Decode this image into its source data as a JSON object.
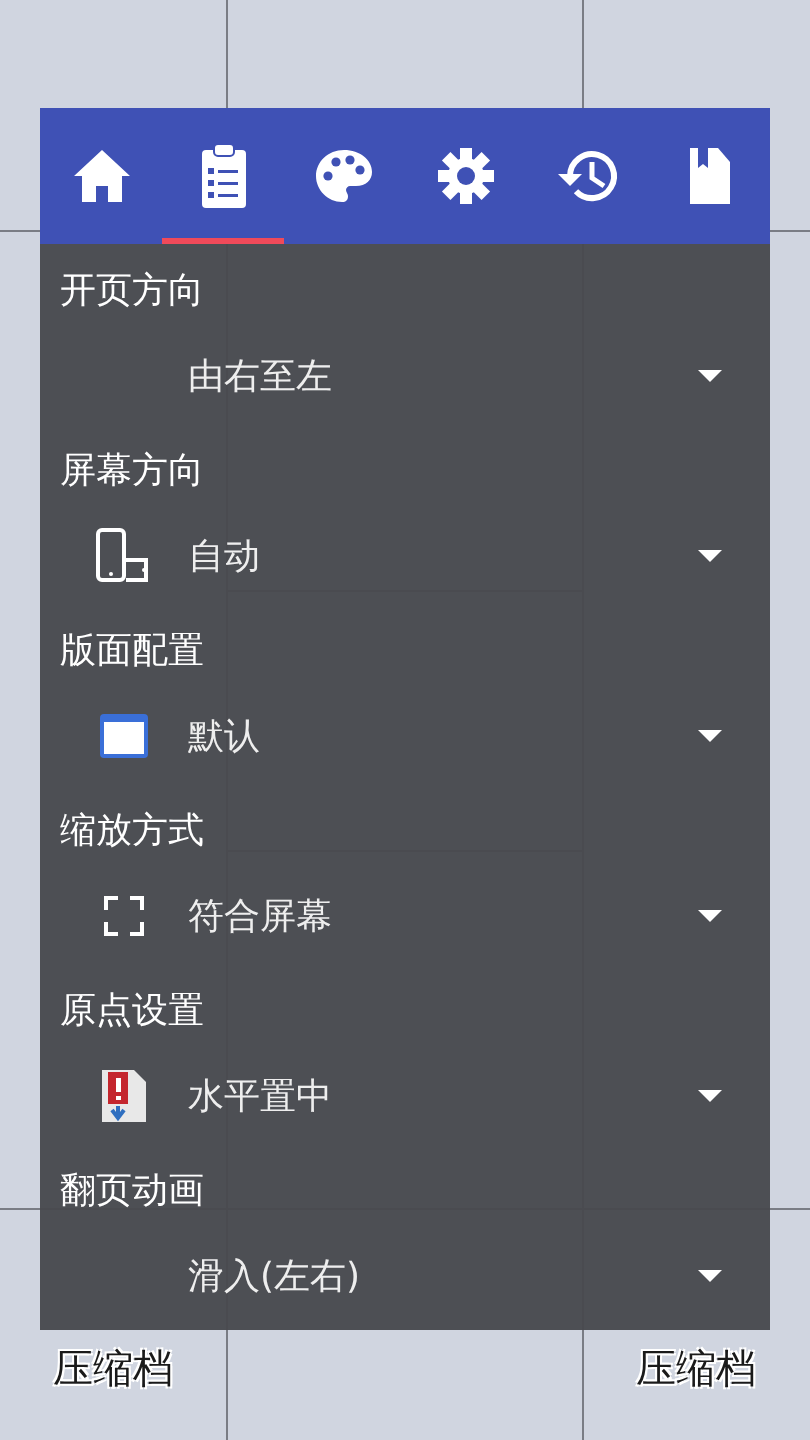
{
  "background_zones": [
    {
      "label": "压缩档"
    },
    {
      "label": "压缩档"
    }
  ],
  "tabs": [
    {
      "kind": "home",
      "selected": false
    },
    {
      "kind": "clipboard",
      "selected": true
    },
    {
      "kind": "palette",
      "selected": false
    },
    {
      "kind": "gear",
      "selected": false
    },
    {
      "kind": "history",
      "selected": false
    },
    {
      "kind": "bookmark",
      "selected": false
    }
  ],
  "settings": [
    {
      "label": "开页方向",
      "value": "由右至左",
      "kind": "plain"
    },
    {
      "label": "屏幕方向",
      "value": "自动",
      "kind": "rotate"
    },
    {
      "label": "版面配置",
      "value": "默认",
      "kind": "window"
    },
    {
      "label": "缩放方式",
      "value": "符合屏幕",
      "kind": "fit"
    },
    {
      "label": "原点设置",
      "value": "水平置中",
      "kind": "origin"
    },
    {
      "label": "翻页动画",
      "value": "滑入(左右)",
      "kind": "plain"
    }
  ]
}
